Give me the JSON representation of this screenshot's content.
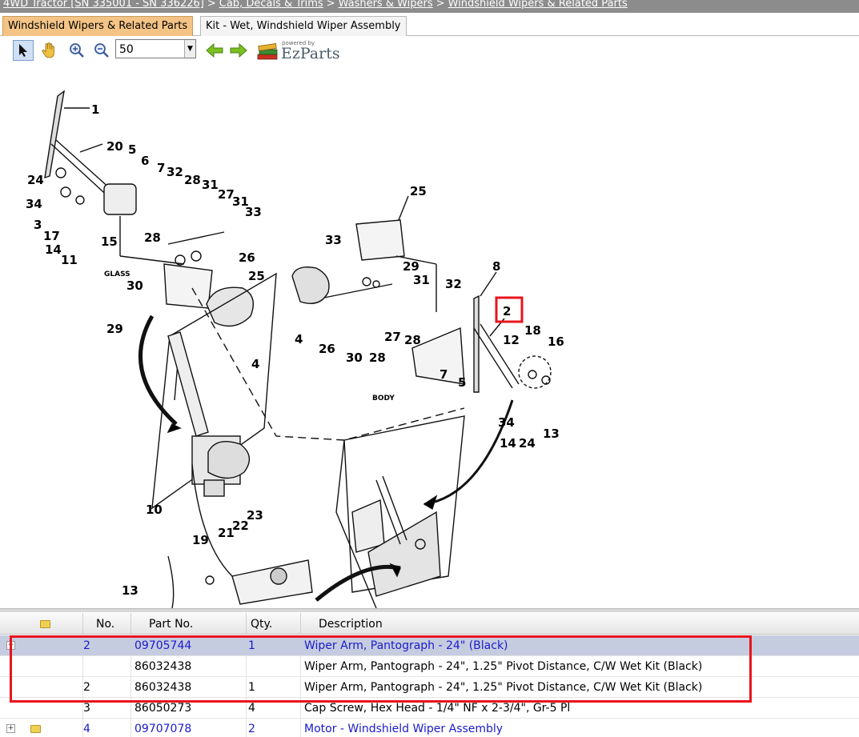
{
  "breadcrumb": {
    "items": [
      "4WD Tractor [SN 335001 - SN 336226]",
      "Cab, Decals & Trims",
      "Washers & Wipers",
      "Windshield Wipers & Related Parts"
    ],
    "separator": ">"
  },
  "tabs": [
    {
      "label": "Windshield Wipers & Related Parts",
      "active": true
    },
    {
      "label": "Kit - Wet, Windshield Wiper Assembly",
      "active": false
    }
  ],
  "toolbar": {
    "zoom_value": "50",
    "icons": [
      "pointer-icon",
      "hand-icon",
      "zoom-in-icon",
      "zoom-out-icon",
      "arrow-left-icon",
      "arrow-right-icon"
    ],
    "logo_powered": "powered by",
    "logo_brand": "EzParts"
  },
  "diagram": {
    "callouts": [
      "1",
      "20",
      "24",
      "34",
      "5",
      "6",
      "7",
      "32",
      "28",
      "31",
      "27",
      "31",
      "33",
      "3",
      "17",
      "14",
      "11",
      "15",
      "28",
      "26",
      "GLASS",
      "30",
      "25",
      "29",
      "4",
      "25",
      "33",
      "29",
      "31",
      "32",
      "8",
      "2",
      "18",
      "12",
      "16",
      "4",
      "26",
      "30",
      "28",
      "27",
      "28",
      "7",
      "5",
      "BODY",
      "34",
      "14",
      "24",
      "13",
      "10",
      "23",
      "22",
      "21",
      "19",
      "13"
    ],
    "highlighted_callout": "2"
  },
  "grid": {
    "headers": {
      "no": "No.",
      "part_no": "Part No.",
      "qty": "Qty.",
      "description": "Description"
    },
    "rows": [
      {
        "no": "2",
        "part_no": "09705744",
        "qty": "1",
        "description": "Wiper Arm, Pantograph - 24\" (Black)"
      },
      {
        "no": "",
        "part_no": "86032438",
        "qty": "",
        "description": "Wiper Arm, Pantograph - 24\", 1.25\" Pivot Distance, C/W Wet Kit (Black)"
      },
      {
        "no": "2",
        "part_no": "86032438",
        "qty": "1",
        "description": "Wiper Arm, Pantograph - 24\", 1.25\" Pivot Distance, C/W Wet Kit (Black)"
      },
      {
        "no": "3",
        "part_no": "86050273",
        "qty": "4",
        "description": "Cap Screw, Hex Head - 1/4\" NF x 2-3/4\", Gr-5 Pl"
      },
      {
        "no": "4",
        "part_no": "09707078",
        "qty": "2",
        "description": "Motor - Windshield Wiper Assembly"
      }
    ]
  },
  "colors": {
    "selected_row": "#c6cce0",
    "link_blue": "#1a1acc",
    "highlight_red": "#e8141e",
    "active_tab": "#f4c486"
  }
}
